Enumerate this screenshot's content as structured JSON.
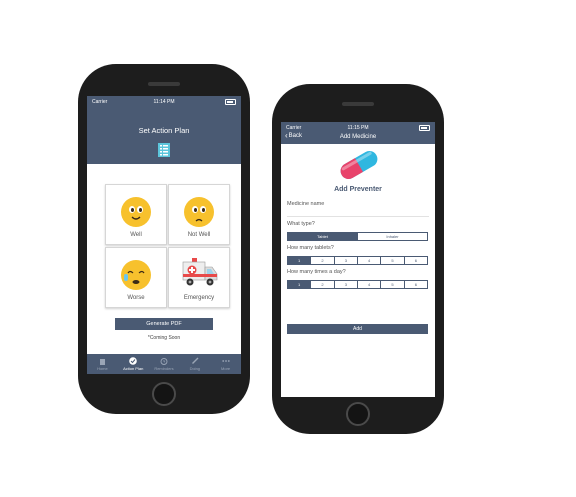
{
  "phone1": {
    "status": {
      "carrier": "Carrier",
      "time": "11:14 PM"
    },
    "title": "Set Action Plan",
    "tiles": [
      {
        "label": "Well",
        "icon": "smiling-face-icon"
      },
      {
        "label": "Not Well",
        "icon": "frowning-face-icon"
      },
      {
        "label": "Worse",
        "icon": "crying-face-icon"
      },
      {
        "label": "Emergency",
        "icon": "ambulance-icon"
      }
    ],
    "generate_label": "Generate PDF",
    "coming_soon": "*Coming Soon",
    "tabs": [
      {
        "label": "Home",
        "icon": "home-icon"
      },
      {
        "label": "Action Plan",
        "icon": "check-circle-icon",
        "active": true
      },
      {
        "label": "Reminders",
        "icon": "alarm-clock-icon"
      },
      {
        "label": "Doing",
        "icon": "inhaler-icon"
      },
      {
        "label": "More",
        "icon": "more-dots-icon"
      }
    ]
  },
  "phone2": {
    "status": {
      "carrier": "Carrier",
      "time": "11:15 PM"
    },
    "back_label": "Back",
    "title": "Add Medicine",
    "heading": "Add Preventer",
    "medicine_name_placeholder": "Medicine name",
    "type_label": "What type?",
    "type_options": [
      "Tablet",
      "Inhaler"
    ],
    "tablets_label": "How many tablets?",
    "times_label": "How many times a day?",
    "count_options": [
      "1",
      "2",
      "3",
      "4",
      "5",
      "6"
    ],
    "add_label": "Add",
    "colors": {
      "primary": "#4a5a73",
      "pill_red": "#e8436b",
      "pill_blue": "#2fb7e0"
    }
  }
}
